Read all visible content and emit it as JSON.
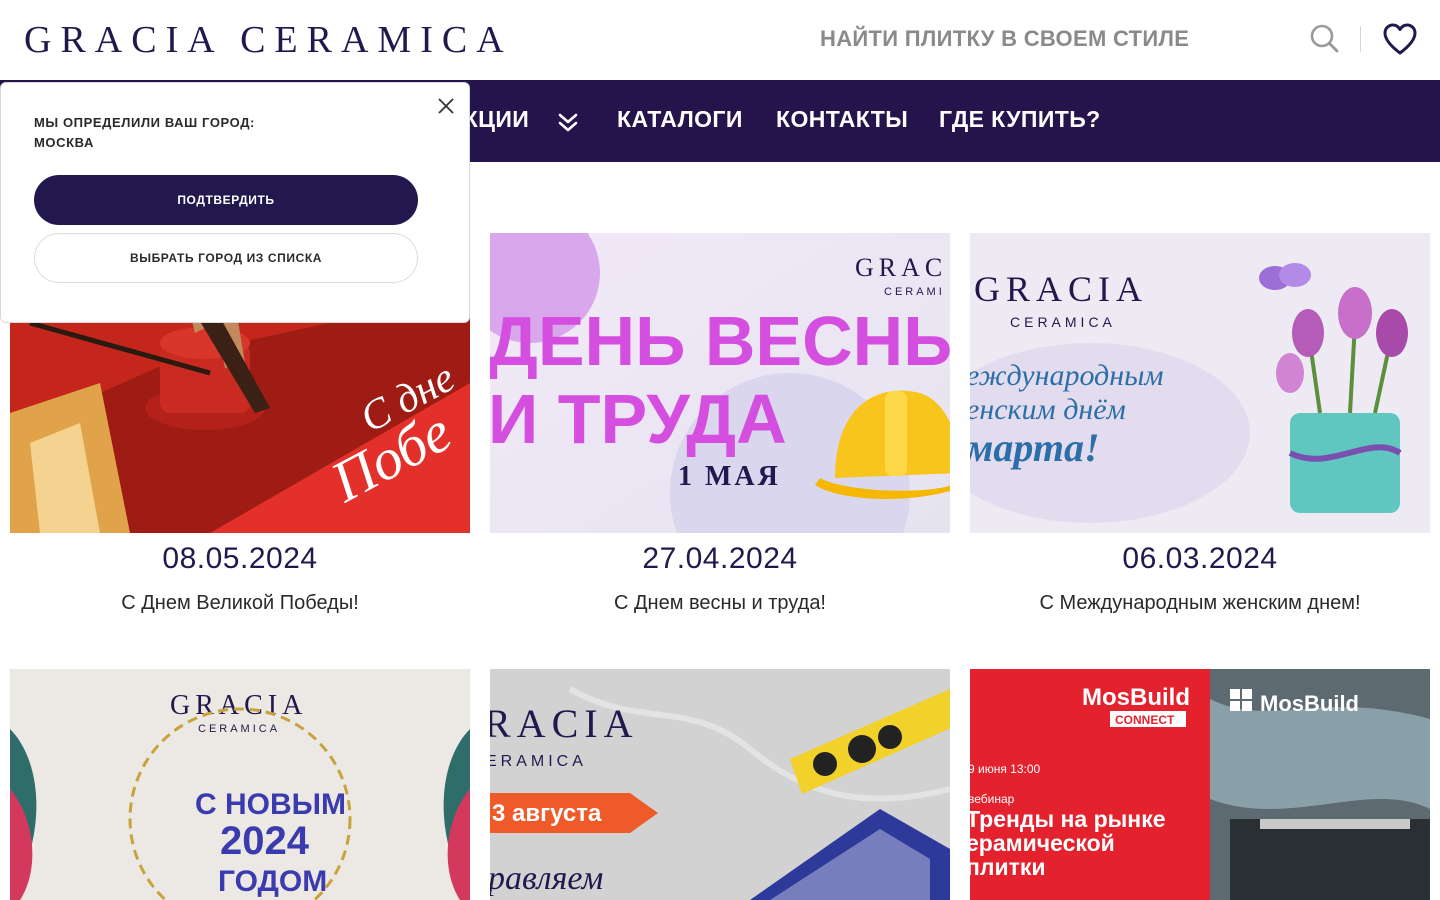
{
  "header": {
    "logo_text": "GRACIA CERAMICA",
    "search_placeholder": "НАЙТИ ПЛИТКУ В СВОЕМ СТИЛЕ"
  },
  "nav": {
    "items": [
      {
        "label": "ЕКЦИИ"
      },
      {
        "label": "КАТАЛОГИ"
      },
      {
        "label": "КОНТАКТЫ"
      },
      {
        "label": "ГДЕ КУПИТЬ?"
      }
    ]
  },
  "city_popup": {
    "question": "МЫ ОПРЕДЕЛИЛИ ВАШ ГОРОД:",
    "city": "МОСКВА",
    "confirm_label": "ПОДТВЕРДИТЬ",
    "choose_label": "ВЫБРАТЬ ГОРОД ИЗ СПИСКА"
  },
  "news": [
    {
      "date": "08.05.2024",
      "title": "С Днем Великой Победы!",
      "image_text": [
        "С дне",
        "Побе"
      ]
    },
    {
      "date": "27.04.2024",
      "title": "С Днем весны и труда!",
      "image_text": [
        "GRAC",
        "CERAMI",
        "ДЕНЬ ВЕСНЫ",
        "И ТРУДА",
        "1 МАЯ"
      ]
    },
    {
      "date": "06.03.2024",
      "title": "С Международным женским днем!",
      "image_text": [
        "GRACIA",
        "CERAMICA",
        "еждународным",
        "енским днём",
        "марта!"
      ]
    },
    {
      "date": "",
      "title": "",
      "image_text": [
        "GRACIA",
        "CERAMICA",
        "С НОВЫМ",
        "2024",
        "ГОДОМ"
      ]
    },
    {
      "date": "",
      "title": "",
      "image_text": [
        "RACIA",
        "ERAMICA",
        "3 августа",
        "равляем"
      ]
    },
    {
      "date": "",
      "title": "",
      "image_text": [
        "MosBuild",
        "CONNECT",
        "9 июня 13:00",
        "вебинар",
        "Тренды на рынке",
        "ерамической",
        "плитки",
        "MosBuild"
      ]
    }
  ],
  "colors": {
    "brand_dark": "#25134c",
    "accent_magenta": "#d44fe0",
    "mosbuild_red": "#e4222e"
  }
}
